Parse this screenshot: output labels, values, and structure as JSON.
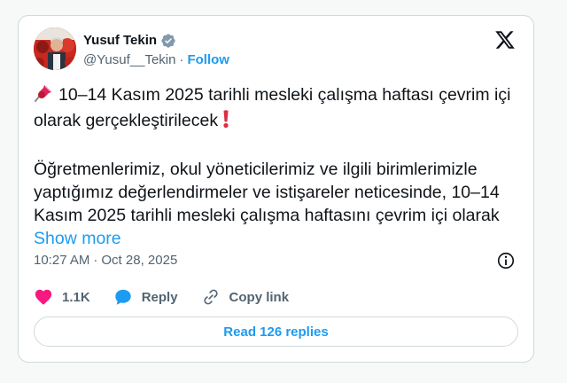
{
  "author": {
    "name": "Yusuf Tekin",
    "handle": "@Yusuf__Tekin",
    "separator": "·",
    "follow_label": "Follow",
    "verified_color": "#829aab"
  },
  "tweet": {
    "line1_icon": "pushpin-emoji",
    "line1": "10–14 Kasım 2025 tarihli mesleki çalışma haftası çevrim içi olarak gerçekleştirilecek",
    "line1_end_icon": "exclamation-emoji",
    "paragraph2": "Öğretmenlerimiz, okul yöneticilerimiz ve ilgili birimlerimizle yaptığımız değerlendirmeler ve istişareler neticesinde, 10–14 Kasım 2025 tarihli mesleki çalışma haftasını çevrim içi olarak",
    "show_more": "Show more"
  },
  "meta": {
    "time": "10:27 AM",
    "separator": "·",
    "date": "Oct 28, 2025"
  },
  "actions": {
    "like_count": "1.1K",
    "reply_label": "Reply",
    "copy_link_label": "Copy link"
  },
  "read_replies_label": "Read 126 replies",
  "colors": {
    "accent": "#1d9bf0",
    "like": "#f91880",
    "secondary_text": "#536471",
    "border": "#cfd9de"
  }
}
